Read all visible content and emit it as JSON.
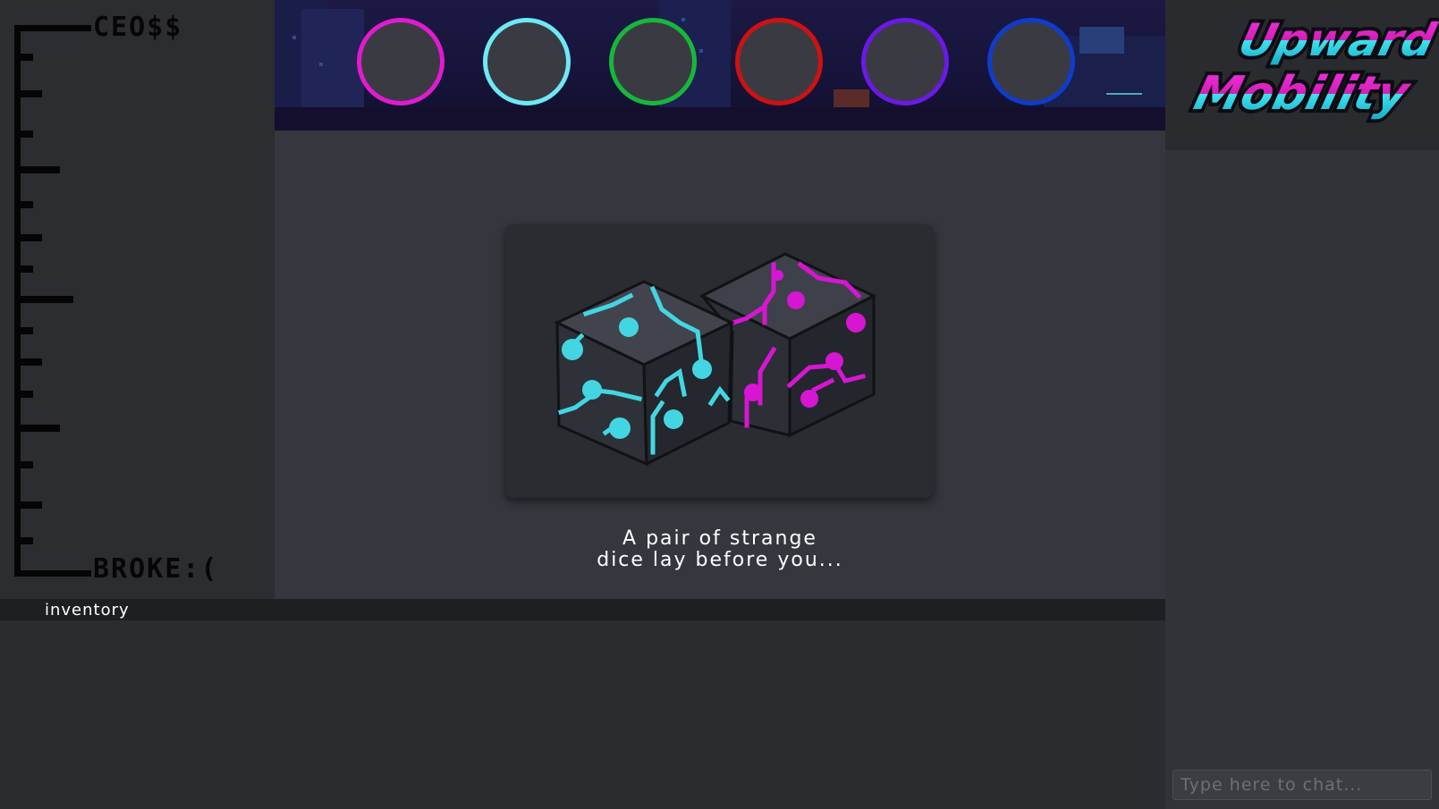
{
  "ladder": {
    "top_label": "CEO$$",
    "bottom_label": "BROKE:("
  },
  "players": {
    "slot_colors": [
      "#e01bd0",
      "#6de9f4",
      "#16b83b",
      "#cf1111",
      "#6a19e6",
      "#0f3ccc"
    ]
  },
  "dice": {
    "left_die_color": "#43d6e2",
    "right_die_color": "#d616d2"
  },
  "message": {
    "line1": "A pair of strange",
    "line2": "dice lay before you..."
  },
  "inventory": {
    "label": "inventory"
  },
  "logo": {
    "line1": "Upward",
    "line2": "Mobility"
  },
  "chat": {
    "placeholder": "Type here to chat..."
  }
}
